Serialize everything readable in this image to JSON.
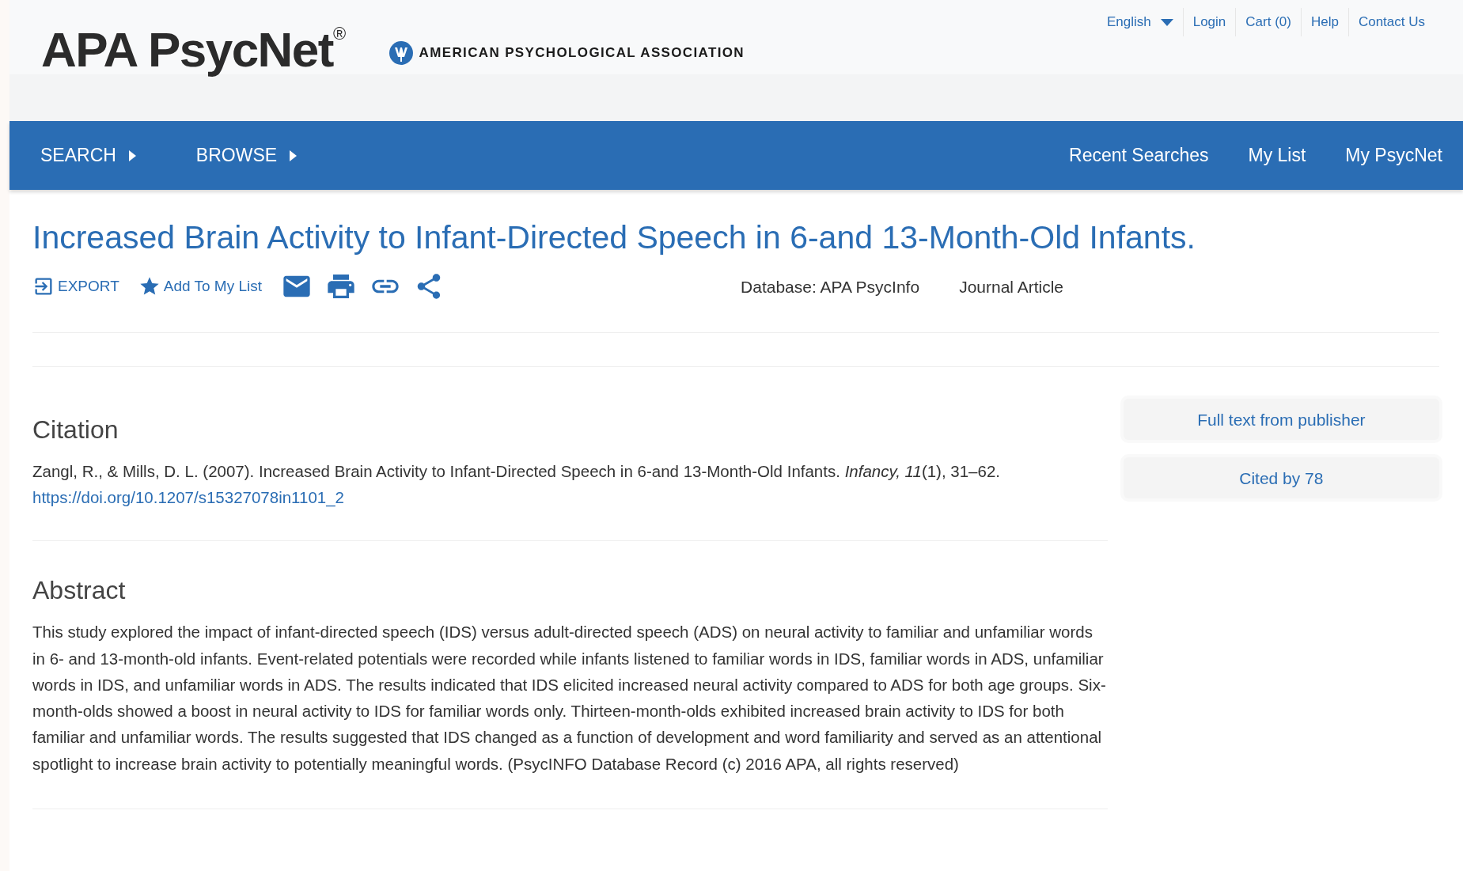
{
  "header": {
    "logo": "APA PsycNet",
    "logo_mark": "®",
    "organization": "AMERICAN PSYCHOLOGICAL ASSOCIATION",
    "top_links": [
      {
        "label": "English",
        "kind": "dropdown"
      },
      {
        "label": "Login",
        "kind": "link"
      },
      {
        "label": "Cart (0)",
        "kind": "link"
      },
      {
        "label": "Help",
        "kind": "link"
      },
      {
        "label": "Contact Us",
        "kind": "link"
      }
    ]
  },
  "nav": {
    "left": [
      {
        "label": "SEARCH"
      },
      {
        "label": "BROWSE"
      }
    ],
    "right": [
      "Recent Searches",
      "My List",
      "My PsycNet"
    ]
  },
  "article": {
    "title": "Increased Brain Activity to Infant-Directed Speech in 6-and 13-Month-Old Infants.",
    "actions": [
      {
        "kind": "export",
        "label": "EXPORT"
      },
      {
        "kind": "add",
        "label": "Add To My List"
      },
      {
        "kind": "email"
      },
      {
        "kind": "print"
      },
      {
        "kind": "link"
      },
      {
        "kind": "share"
      }
    ],
    "meta": [
      "Database: APA PsycInfo",
      "Journal Article"
    ]
  },
  "citation": {
    "heading": "Citation",
    "text": "Zangl, R., & Mills, D. L. (2007). Increased Brain Activity to Infant-Directed Speech in 6-and 13-Month-Old Infants. *Infancy, 11*(1), 31–62.",
    "doi": "https://doi.org/10.1207/s15327078in1101_2"
  },
  "abstract": {
    "heading": "Abstract",
    "text": "This study explored the impact of infant-directed speech (IDS) versus adult-directed speech (ADS) on neural activity to familiar and unfamiliar words in 6- and 13-month-old infants. Event-related potentials were recorded while infants listened to familiar words in IDS, familiar words in ADS, unfamiliar words in IDS, and unfamiliar words in ADS. The results indicated that IDS elicited increased neural activity compared to ADS for both age groups. Six-month-olds showed a boost in neural activity to IDS for familiar words only. Thirteen-month-olds exhibited increased brain activity to IDS for both familiar and unfamiliar words. The results suggested that IDS changed as a function of development and word familiarity and served as an attentional spotlight to increase brain activity to potentially meaningful words. (PsycINFO Database Record (c) 2016 APA, all rights reserved)"
  },
  "side_buttons": [
    "Full text from publisher",
    "Cited by 78"
  ]
}
